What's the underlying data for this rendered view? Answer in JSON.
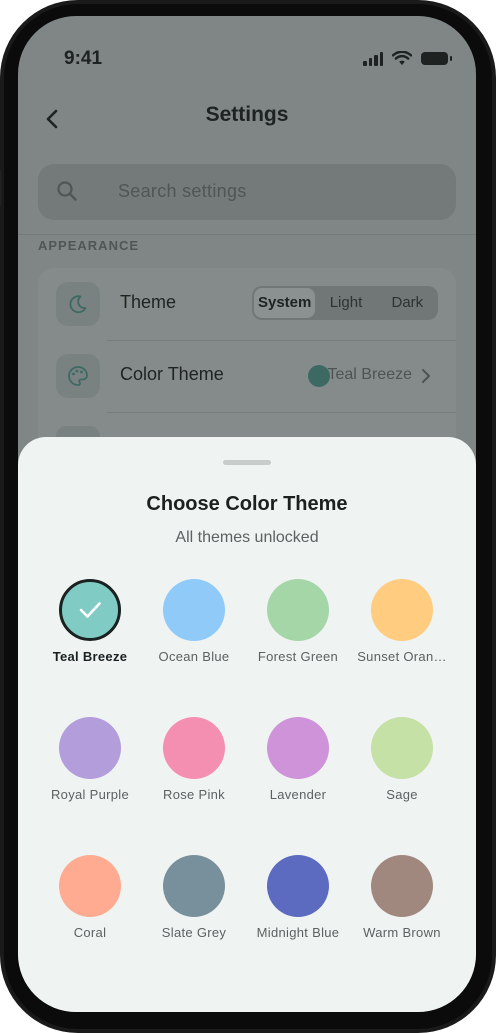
{
  "status": {
    "time": "9:41"
  },
  "nav": {
    "back_icon": "chevron-left-icon",
    "title": "Settings"
  },
  "search": {
    "placeholder": "Search settings",
    "icon": "search-icon"
  },
  "appearance": {
    "section_label": "APPEARANCE",
    "theme": {
      "label": "Theme",
      "icon": "moon-icon",
      "options": [
        "System",
        "Light",
        "Dark"
      ],
      "selected": "System"
    },
    "color_theme": {
      "label": "Color Theme",
      "icon": "palette-icon",
      "value": "Teal Breeze",
      "dot_color": "#3c6a63"
    }
  },
  "sheet": {
    "title": "Choose Color Theme",
    "subtitle": "All themes unlocked",
    "selected": "Teal Breeze",
    "themes": [
      {
        "name": "Teal Breeze",
        "label": "Teal Breeze",
        "color": "#80cbc4",
        "selected": true
      },
      {
        "name": "Ocean Blue",
        "label": "Ocean Blue",
        "color": "#90caf9",
        "selected": false
      },
      {
        "name": "Forest Green",
        "label": "Forest Green",
        "color": "#a5d6a7",
        "selected": false
      },
      {
        "name": "Sunset Orange",
        "label": "Sunset Oran…",
        "color": "#ffcc80",
        "selected": false
      },
      {
        "name": "Royal Purple",
        "label": "Royal Purple",
        "color": "#b39ddb",
        "selected": false
      },
      {
        "name": "Rose Pink",
        "label": "Rose Pink",
        "color": "#f48fb1",
        "selected": false
      },
      {
        "name": "Lavender",
        "label": "Lavender",
        "color": "#ce93d8",
        "selected": false
      },
      {
        "name": "Sage",
        "label": "Sage",
        "color": "#c5e1a5",
        "selected": false
      },
      {
        "name": "Coral",
        "label": "Coral",
        "color": "#ffab91",
        "selected": false
      },
      {
        "name": "Slate Grey",
        "label": "Slate Grey",
        "color": "#78909c",
        "selected": false
      },
      {
        "name": "Midnight Blue",
        "label": "Midnight Blue",
        "color": "#5c6bc0",
        "selected": false
      },
      {
        "name": "Warm Brown",
        "label": "Warm Brown",
        "color": "#a1887f",
        "selected": false
      }
    ]
  }
}
